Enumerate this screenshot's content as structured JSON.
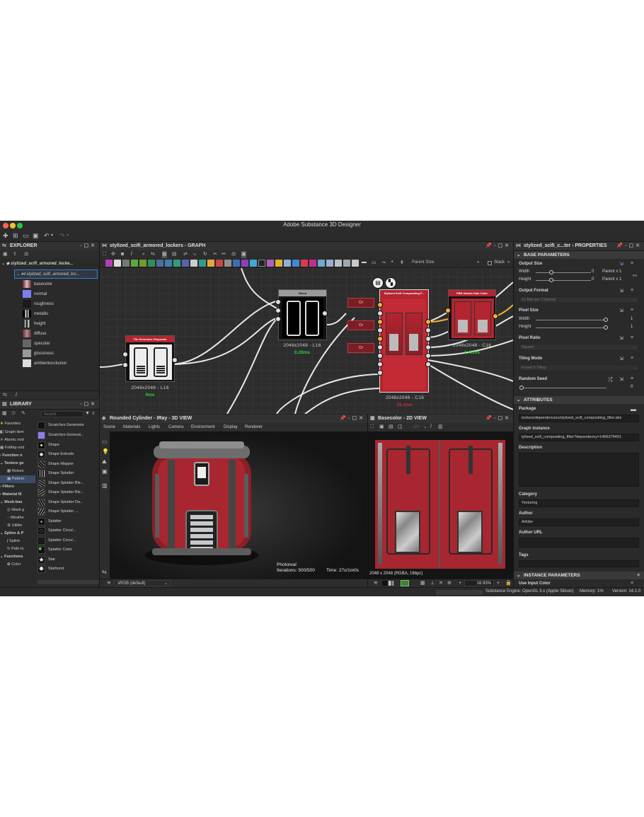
{
  "app": {
    "title": "Adobe Substance 3D Designer"
  },
  "explorer": {
    "header": "EXPLORER",
    "package": "stylized_scifi_armored_locke...",
    "graph": "stylized_scifi_armored_loc...",
    "outputs": [
      "basecolor",
      "normal",
      "roughness",
      "metallic",
      "height",
      "diffuse",
      "specular",
      "glossiness",
      "ambientocclusion"
    ]
  },
  "library": {
    "header": "LIBRARY",
    "search_placeholder": "Search",
    "categories": [
      "Favorites",
      "Graph item",
      "Atomic nod",
      "FxMap nod",
      "Function n",
      "Texture ge",
      "Noises",
      "Pattern",
      "Filters",
      "Material fil",
      "Mesh-bas",
      "Mask g",
      "Weathe",
      "Utilitie",
      "Spline & P",
      "Spline",
      "Path to",
      "Functions",
      "Color"
    ],
    "items": [
      "Scratches Generator",
      "Scratches Generat...",
      "Shape",
      "Shape Extrude",
      "Shape Mapper",
      "Shape Splatter",
      "Shape Splatter Ble...",
      "Shape Splatter Ble...",
      "Shape Splatter Da...",
      "Shape Splatter ...",
      "Splatter",
      "Splatter Circul...",
      "Splatter Circul...",
      "Splatter Color",
      "Star",
      "Starburst"
    ]
  },
  "graph": {
    "header": "stylized_scifi_armored_lockers - GRAPH",
    "parent_size_label": "Parent Size:",
    "stack_label": "Stack",
    "nodes": {
      "tile": {
        "title": "Tile Generator Grayscale",
        "size": "2048x2048 - L16",
        "time": "0ms"
      },
      "blend": {
        "title": "Blend",
        "size": "2048x2048 - L16",
        "time": "0.28ms"
      },
      "compositing": {
        "title": "Stylized Scifi Compositing F...",
        "size": "2048x2048 - C16",
        "time": "11.1ms"
      },
      "albedo": {
        "title": "PBR Albedo Safe Color",
        "size": "2048x2048 - C16",
        "time": "1.41ms"
      },
      "clr_label": "Clr"
    }
  },
  "view3d": {
    "header": "Rounded Cylinder - IRay - 3D VIEW",
    "menu": [
      "Scene",
      "Materials",
      "Lights",
      "Camera",
      "Environment",
      "Display",
      "Renderer"
    ],
    "render_mode": "Photoreal",
    "iterations": "Iterations: 500/500",
    "time": "Time: 27s/1m0s",
    "colorspace": "sRGB (default)"
  },
  "view2d": {
    "header": "Basecolor - 2D VIEW",
    "info": "2048 x 2048 (RGBA, 16bpc)",
    "zoom": "16.93%"
  },
  "properties": {
    "header": "stylized_scifi_c...ter - PROPERTIES",
    "base_parameters": "BASE PARAMETERS",
    "output_size": {
      "label": "Output Size",
      "width_label": "Width",
      "height_label": "Height",
      "width_value": "0",
      "height_value": "0",
      "width_rel": "Parent x 1",
      "height_rel": "Parent x 1"
    },
    "output_format": {
      "label": "Output Format",
      "value": "16 Bits per Channel"
    },
    "pixel_size": {
      "label": "Pixel Size",
      "width_label": "Width",
      "height_label": "Height",
      "width_value": "1",
      "height_value": "1"
    },
    "pixel_ratio": {
      "label": "Pixel Ratio",
      "value": "Square"
    },
    "tiling_mode": {
      "label": "Tiling Mode",
      "value": "H and V Tiling"
    },
    "random_seed": {
      "label": "Random Seed",
      "value": "0"
    },
    "attributes": "ATTRIBUTES",
    "package": {
      "label": "Package",
      "value": "lockers/dependencies/stylized_scifi_compositing_filter.sbs"
    },
    "graph_instance": {
      "label": "Graph instance",
      "value": "tylized_scifi_compositing_filter?dependency=1466376401"
    },
    "description_label": "Description",
    "category": {
      "label": "Category",
      "value": "Texturing"
    },
    "author": {
      "label": "Author",
      "value": "Adobe"
    },
    "author_url_label": "Author URL",
    "tags_label": "Tags",
    "instance_parameters": "INSTANCE PARAMETERS",
    "use_input_color": "Use Input Color"
  },
  "status": {
    "engine": "Substance Engine: OpenGL 3.x (Apple Silicon)",
    "memory": "Memory: 1%",
    "version": "Version: 14.1.0"
  },
  "colors": {
    "node_red": "#b32530",
    "accent_orange": "#f2b03d",
    "timing_green": "#27d13a",
    "panel_bg": "#2a2a2a"
  }
}
